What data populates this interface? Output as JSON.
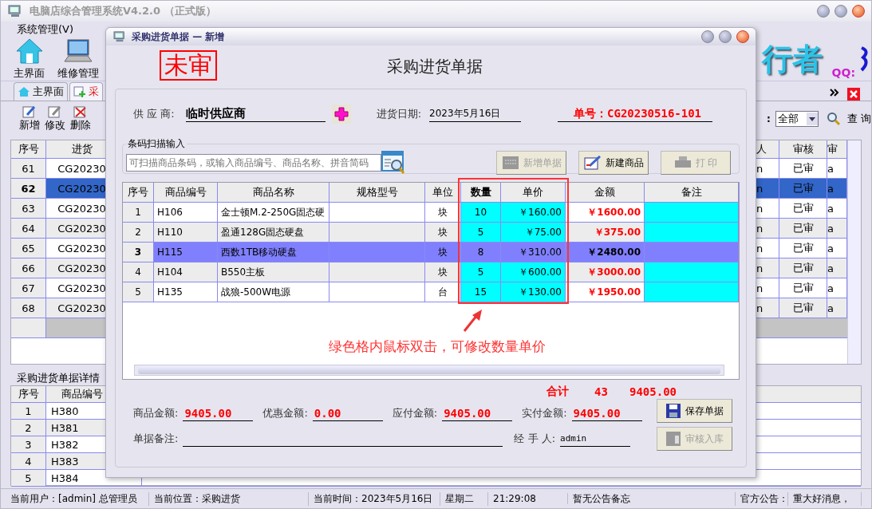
{
  "window": {
    "title": "电脑店综合管理系统V4.2.0 （正式版）"
  },
  "menu": [
    {
      "label": "系统管理(V)"
    }
  ],
  "toolbar": [
    {
      "label": "主界面"
    },
    {
      "label": "维修管理"
    }
  ],
  "logo": {
    "text": "行者",
    "qq": "QQ:"
  },
  "tabs": [
    {
      "label": "主界面",
      "selected": false
    },
    {
      "label": "采",
      "selected": true
    }
  ],
  "actions": [
    {
      "label": "新增"
    },
    {
      "label": "修改"
    },
    {
      "label": "删除"
    }
  ],
  "filter": {
    "label": ":",
    "value": "全部",
    "search": "查 询"
  },
  "orders": {
    "columns_left": [
      "序号",
      "进货"
    ],
    "columns_right": [
      "人",
      "审核",
      "审"
    ],
    "rows": [
      {
        "no": "61",
        "code": "CG20230",
        "c1": "n",
        "status": "已审",
        "c3": "a",
        "selected": false
      },
      {
        "no": "62",
        "code": "CG20230",
        "c1": "n",
        "status": "已审",
        "c3": "a",
        "selected": true
      },
      {
        "no": "63",
        "code": "CG20230",
        "c1": "n",
        "status": "已审",
        "c3": "a",
        "selected": false
      },
      {
        "no": "64",
        "code": "CG20230",
        "c1": "n",
        "status": "已审",
        "c3": "a",
        "selected": false
      },
      {
        "no": "65",
        "code": "CG20230",
        "c1": "n",
        "status": "已审",
        "c3": "a",
        "selected": false
      },
      {
        "no": "66",
        "code": "CG20230",
        "c1": "n",
        "status": "已审",
        "c3": "a",
        "selected": false
      },
      {
        "no": "67",
        "code": "CG20230",
        "c1": "n",
        "status": "已审",
        "c3": "a",
        "selected": false
      },
      {
        "no": "68",
        "code": "CG20230",
        "c1": "n",
        "status": "已审",
        "c3": "a",
        "selected": false
      }
    ]
  },
  "details": {
    "title": "采购进货单据详情",
    "columns": [
      "序号",
      "商品编号"
    ],
    "rows": [
      {
        "no": "1",
        "code": "H380"
      },
      {
        "no": "2",
        "code": "H381"
      },
      {
        "no": "3",
        "code": "H382"
      },
      {
        "no": "4",
        "code": "H383"
      },
      {
        "no": "5",
        "code": "H384"
      }
    ]
  },
  "dialog": {
    "title": "采购进货单据 — 新增",
    "stamp": "未审",
    "heading": "采购进货单据",
    "supplier": {
      "label": "供 应 商:",
      "value": "临时供应商"
    },
    "date": {
      "label": "进货日期:",
      "value": "2023年5月16日"
    },
    "number": "单号：CG20230516-101",
    "scan": {
      "legend": "条码扫描输入",
      "placeholder": "可扫描商品条码，或输入商品编号、商品名称、拼音简码"
    },
    "buttons": [
      {
        "label": "新增单据",
        "disabled": true
      },
      {
        "label": "新建商品",
        "disabled": false
      },
      {
        "label": "打 印",
        "disabled": true
      }
    ],
    "columns": [
      "序号",
      "商品编号",
      "商品名称",
      "规格型号",
      "单位",
      "数量",
      "单价",
      "金额",
      "备注"
    ],
    "rows": [
      {
        "no": "1",
        "code": "H106",
        "name": "金士顿M.2-250G固态硬",
        "unit": "块",
        "qty": "10",
        "price": "￥160.00",
        "amount": "￥1600.00",
        "selected": false
      },
      {
        "no": "2",
        "code": "H110",
        "name": "盈通128G固态硬盘",
        "unit": "块",
        "qty": "5",
        "price": "￥75.00",
        "amount": "￥375.00",
        "selected": false
      },
      {
        "no": "3",
        "code": "H115",
        "name": "西数1TB移动硬盘",
        "unit": "块",
        "qty": "8",
        "price": "￥310.00",
        "amount": "￥2480.00",
        "selected": true
      },
      {
        "no": "4",
        "code": "H104",
        "name": "B550主板",
        "unit": "块",
        "qty": "5",
        "price": "￥600.00",
        "amount": "￥3000.00",
        "selected": false
      },
      {
        "no": "5",
        "code": "H135",
        "name": "战狼-500W电源",
        "unit": "台",
        "qty": "15",
        "price": "￥130.00",
        "amount": "￥1950.00",
        "selected": false
      }
    ],
    "annotation": "绿色格内鼠标双击，可修改数量单价",
    "total": {
      "label": "合计",
      "qty": "43",
      "amount": "9405.00"
    },
    "fields": [
      {
        "label": "商品金额:",
        "value": "9405.00"
      },
      {
        "label": "优惠金额:",
        "value": "0.00"
      },
      {
        "label": "应付金额:",
        "value": "9405.00"
      },
      {
        "label": "实付金额:",
        "value": "9405.00"
      }
    ],
    "remark": {
      "label": "单据备注:"
    },
    "handler": {
      "label": "经 手 人:",
      "value": "admin"
    },
    "actions": [
      {
        "label": "保存单据",
        "disabled": false
      },
      {
        "label": "审核入库",
        "disabled": true
      }
    ]
  },
  "status_bar": [
    "当前用户：[admin] 总管理员",
    "当前位置：采购进货",
    "当前时间：2023年5月16日",
    "星期二",
    "21:29:08",
    "暂无公告备忘",
    "官方公告：",
    "重大好消息，"
  ]
}
